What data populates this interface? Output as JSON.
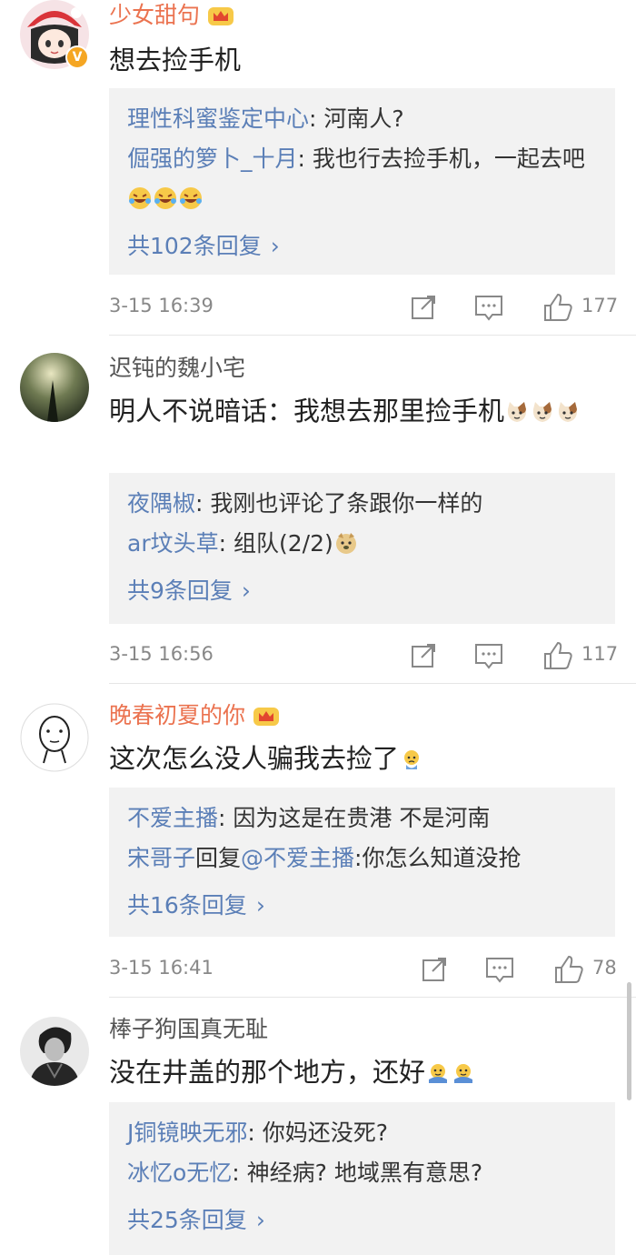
{
  "comments": [
    {
      "username": "少女甜句",
      "text_parts": [
        "想去捡手机"
      ],
      "replies": [
        {
          "name": "理性科蜜鉴定中心",
          "text": "河南人?"
        },
        {
          "name": "倔强的箩卜_十月",
          "text": "我也行去捡手机，一起去吧"
        }
      ],
      "more": "共102条回复",
      "date": "3-15 16:39",
      "likes": "177"
    },
    {
      "username": "迟钝的魏小宅",
      "text_parts": [
        "明人不说暗话：我想去那里捡手机"
      ],
      "replies": [
        {
          "name": "夜隅椒",
          "text": "我刚也评论了条跟你一样的"
        },
        {
          "name": "ar坟头草",
          "text": "组队(2/2)"
        }
      ],
      "more": "共9条回复",
      "date": "3-15 16:56",
      "likes": "117"
    },
    {
      "username": "晚春初夏的你",
      "text_parts": [
        "这次怎么没人骗我去捡了"
      ],
      "replies": [
        {
          "name": "不爱主播",
          "text": "因为这是在贵港  不是河南"
        },
        {
          "name": "宋哥子",
          "mid": "回复",
          "at": "@不爱主播",
          "text": "你怎么知道没抢"
        }
      ],
      "more": "共16条回复",
      "date": "3-15 16:41",
      "likes": "78"
    },
    {
      "username": "棒子狗国真无耻",
      "text_parts": [
        "没在井盖的那个地方，还好"
      ],
      "replies": [
        {
          "name": "J铜镜映无邪",
          "text": "你妈还没死?"
        },
        {
          "name": "冰忆o无忆",
          "text": "神经病? 地域黑有意思?"
        }
      ],
      "more": "共25条回复"
    }
  ],
  "icons": {
    "vip_badge": "v-badge-icon",
    "crown": "crown-icon",
    "share": "share-icon",
    "comment": "comment-icon",
    "like": "thumbs-up-icon",
    "chevron": "chevron-right-icon"
  },
  "colors": {
    "username_vip": "#eb7350",
    "link_blue": "#5b7fb7",
    "reply_bg": "#f2f2f2",
    "meta_gray": "#888888"
  }
}
